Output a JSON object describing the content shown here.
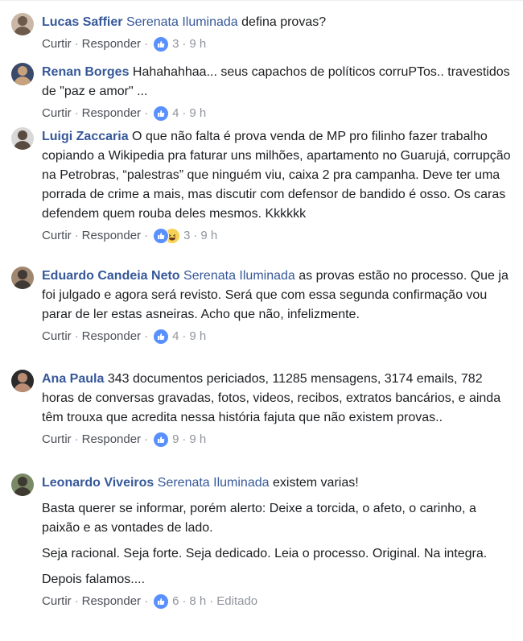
{
  "actions": {
    "like_label": "Curtir",
    "reply_label": "Responder",
    "separator": "·"
  },
  "comments": [
    {
      "author": "Lucas Saffier",
      "mention": "Serenata Iluminada",
      "text": "defina provas?",
      "reaction_count": "3",
      "time": "9 h",
      "avatar_colors": [
        "#c9b8a6",
        "#6d5a4a"
      ]
    },
    {
      "author": "Renan Borges",
      "mention": "",
      "text": "Hahahahhaa... seus capachos de políticos corruPTos.. travestidos de \"paz e amor\" ...",
      "reaction_count": "4",
      "time": "9 h",
      "avatar_colors": [
        "#3b4a6b",
        "#c7a27c"
      ]
    },
    {
      "author": "Luigi Zaccaria",
      "mention": "",
      "text": "O que não falta é prova venda de MP pro filinho fazer trabalho copiando a Wikipedia pra faturar uns milhões, apartamento no Guarujá, corrupção na Petrobras, “palestras” que ninguém viu, caixa 2 pra campanha. Deve ter uma porrada de crime a mais, mas discutir com defensor de bandido é osso. Os caras defendem quem rouba deles mesmos. Kkkkkk",
      "reaction_count": "3",
      "time": "9 h",
      "avatar_colors": [
        "#d8d8d8",
        "#5a4b40"
      ]
    },
    {
      "author": "Eduardo Candeia Neto",
      "mention": "Serenata Iluminada",
      "text": "as provas estão no processo. Que ja foi julgado e agora será revisto. Será que com essa segunda confirmação vou parar de ler estas asneiras. Acho que não, infelizmente.",
      "reaction_count": "4",
      "time": "9 h",
      "avatar_colors": [
        "#a08770",
        "#3f3a35"
      ]
    },
    {
      "author": "Ana Paula",
      "mention": "",
      "text": "343 documentos periciados, 11285 mensagens, 3174 emails, 782 horas de conversas gravadas, fotos, videos, recibos, extratos bancários, e ainda têm trouxa que acredita nessa história fajuta que não existem provas..",
      "reaction_count": "9",
      "time": "9 h",
      "avatar_colors": [
        "#2b2b2b",
        "#b98c73"
      ]
    },
    {
      "author": "Leonardo Viveiros",
      "mention": "Serenata Iluminada",
      "text": "existem varias!",
      "paragraphs": [
        "Basta querer se informar, porém alerto: Deixe a torcida, o afeto, o carinho, a paixão e as vontades de lado.",
        "Seja racional. Seja forte. Seja dedicado. Leia o processo. Original. Na integra.",
        "Depois falamos...."
      ],
      "reaction_count": "6",
      "time": "8 h",
      "edited": "Editado",
      "avatar_colors": [
        "#7b8a66",
        "#3e3a31"
      ]
    }
  ]
}
